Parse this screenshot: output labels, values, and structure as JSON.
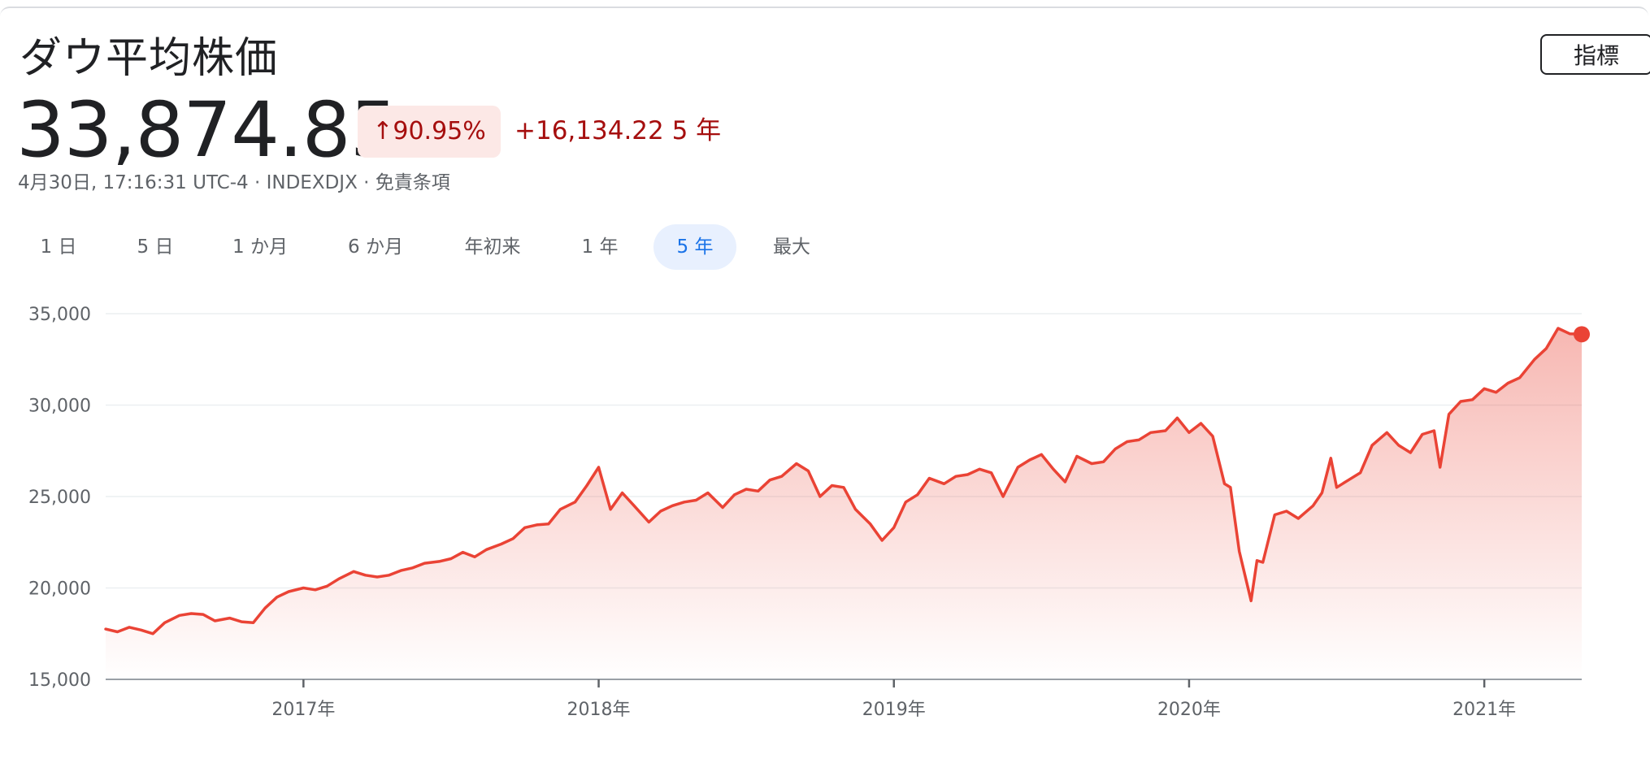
{
  "header": {
    "title": "ダウ平均株価",
    "indicator_button": "指標",
    "price": "33,874.85",
    "change_pct": "↑90.95%",
    "change_abs": "+16,134.22 5 年",
    "meta": "4月30日, 17:16:31 UTC-4 · INDEXDJX · 免責条項"
  },
  "ranges": [
    {
      "label": "1 日",
      "active": false
    },
    {
      "label": "5 日",
      "active": false
    },
    {
      "label": "1 か月",
      "active": false
    },
    {
      "label": "6 か月",
      "active": false
    },
    {
      "label": "年初来",
      "active": false
    },
    {
      "label": "1 年",
      "active": false
    },
    {
      "label": "5 年",
      "active": true
    },
    {
      "label": "最大",
      "active": false
    }
  ],
  "colors": {
    "line": "#ea4335",
    "change": "#a50e0e",
    "change_bg": "#fce8e6",
    "active_tab": "#1a73e8",
    "active_tab_bg": "#e8f0fe"
  },
  "chart_data": {
    "type": "area",
    "title": "",
    "xlabel": "",
    "ylabel": "",
    "x_ticks": [
      {
        "x": 2017.0,
        "label": "2017年"
      },
      {
        "x": 2018.0,
        "label": "2018年"
      },
      {
        "x": 2019.0,
        "label": "2019年"
      },
      {
        "x": 2020.0,
        "label": "2020年"
      },
      {
        "x": 2021.0,
        "label": "2021年"
      }
    ],
    "y_ticks": [
      {
        "y": 15000,
        "label": "15,000"
      },
      {
        "y": 20000,
        "label": "20,000"
      },
      {
        "y": 25000,
        "label": "25,000"
      },
      {
        "y": 30000,
        "label": "30,000"
      },
      {
        "y": 35000,
        "label": "35,000"
      }
    ],
    "xlim": [
      2016.33,
      2021.33
    ],
    "ylim": [
      15000,
      35000
    ],
    "grid": true,
    "series": [
      {
        "x": [
          2016.33,
          2016.37,
          2016.41,
          2016.45,
          2016.49,
          2016.53,
          2016.58,
          2016.62,
          2016.66,
          2016.7,
          2016.75,
          2016.79,
          2016.83,
          2016.87,
          2016.91,
          2016.95,
          2017.0,
          2017.04,
          2017.08,
          2017.12,
          2017.17,
          2017.21,
          2017.25,
          2017.29,
          2017.33,
          2017.37,
          2017.41,
          2017.46,
          2017.5,
          2017.54,
          2017.58,
          2017.62,
          2017.67,
          2017.71,
          2017.75,
          2017.79,
          2017.83,
          2017.87,
          2017.92,
          2017.96,
          2018.0,
          2018.04,
          2018.08,
          2018.12,
          2018.17,
          2018.21,
          2018.25,
          2018.29,
          2018.33,
          2018.37,
          2018.42,
          2018.46,
          2018.5,
          2018.54,
          2018.58,
          2018.62,
          2018.67,
          2018.71,
          2018.75,
          2018.79,
          2018.83,
          2018.87,
          2018.92,
          2018.96,
          2019.0,
          2019.04,
          2019.08,
          2019.12,
          2019.17,
          2019.21,
          2019.25,
          2019.29,
          2019.33,
          2019.37,
          2019.42,
          2019.46,
          2019.5,
          2019.54,
          2019.58,
          2019.62,
          2019.67,
          2019.71,
          2019.75,
          2019.79,
          2019.83,
          2019.87,
          2019.92,
          2019.96,
          2020.0,
          2020.04,
          2020.08,
          2020.12,
          2020.14,
          2020.17,
          2020.21,
          2020.23,
          2020.25,
          2020.29,
          2020.33,
          2020.37,
          2020.42,
          2020.45,
          2020.48,
          2020.5,
          2020.54,
          2020.58,
          2020.62,
          2020.67,
          2020.71,
          2020.75,
          2020.79,
          2020.83,
          2020.85,
          2020.88,
          2020.92,
          2020.96,
          2021.0,
          2021.04,
          2021.08,
          2021.12,
          2021.17,
          2021.21,
          2021.25,
          2021.29,
          2021.33
        ],
        "y": [
          17750,
          17600,
          17850,
          17700,
          17500,
          18100,
          18500,
          18600,
          18550,
          18200,
          18350,
          18150,
          18100,
          18900,
          19500,
          19800,
          20000,
          19900,
          20100,
          20500,
          20900,
          20700,
          20600,
          20700,
          20950,
          21100,
          21350,
          21450,
          21600,
          21950,
          21700,
          22100,
          22400,
          22700,
          23300,
          23450,
          23500,
          24300,
          24700,
          25600,
          26600,
          24300,
          25200,
          24500,
          23600,
          24200,
          24500,
          24700,
          24800,
          25200,
          24400,
          25100,
          25400,
          25300,
          25900,
          26100,
          26800,
          26400,
          25000,
          25600,
          25500,
          24300,
          23500,
          22600,
          23300,
          24700,
          25100,
          26000,
          25700,
          26100,
          26200,
          26500,
          26300,
          25000,
          26600,
          27000,
          27300,
          26500,
          25800,
          27200,
          26800,
          26900,
          27600,
          28000,
          28100,
          28500,
          28600,
          29300,
          28500,
          29000,
          28300,
          25700,
          25500,
          22000,
          19300,
          21500,
          21400,
          24000,
          24200,
          23800,
          24500,
          25200,
          27100,
          25500,
          25900,
          26300,
          27800,
          28500,
          27800,
          27400,
          28400,
          28600,
          26600,
          29500,
          30200,
          30300,
          30900,
          30700,
          31200,
          31500,
          32500,
          33100,
          34200,
          33900,
          33874.85
        ]
      }
    ]
  }
}
